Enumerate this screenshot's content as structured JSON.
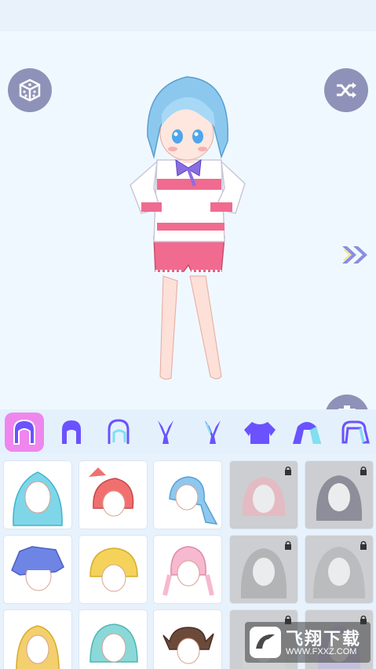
{
  "toolbar": {
    "categories": [
      {
        "name": "hair-full",
        "selected": true
      },
      {
        "name": "hair-back",
        "selected": false
      },
      {
        "name": "hair-front",
        "selected": false
      },
      {
        "name": "ears",
        "selected": false
      },
      {
        "name": "ears-outline",
        "selected": false
      },
      {
        "name": "top",
        "selected": false
      },
      {
        "name": "outer-hair",
        "selected": false
      },
      {
        "name": "headwear",
        "selected": false
      }
    ]
  },
  "grid": {
    "items": [
      {
        "hair_color": "#7fd6e8",
        "locked": false
      },
      {
        "hair_color": "#f07070",
        "locked": false
      },
      {
        "hair_color": "#8ec8ee",
        "locked": false
      },
      {
        "hair_color": "#f3a6b2",
        "locked": true
      },
      {
        "hair_color": "#555566",
        "locked": true
      },
      {
        "hair_color": "#6f85e6",
        "locked": false
      },
      {
        "hair_color": "#f5d35a",
        "locked": false
      },
      {
        "hair_color": "#f6b9cf",
        "locked": false
      },
      {
        "hair_color": "#9a9a9a",
        "locked": true
      },
      {
        "hair_color": "#a8a8a8",
        "locked": true
      },
      {
        "hair_color": "#f4cf6e",
        "locked": false
      },
      {
        "hair_color": "#8ad8d8",
        "locked": false
      },
      {
        "hair_color": "#6b4a3a",
        "locked": false
      },
      {
        "hair_color": "#cfcfcf",
        "locked": true
      },
      {
        "hair_color": "#b9b0e0",
        "locked": true
      }
    ]
  },
  "character": {
    "hair_color": "#8cc8ee",
    "shirt_color": "#ffffff",
    "stripe_color": "#f06b8f",
    "shorts_color": "#f06b8f",
    "bow_color": "#8a6ee0"
  },
  "watermark": {
    "title": "飞翔下载",
    "url": "WWW.FXXZ.COM"
  },
  "colors": {
    "accent": "#ee86ee",
    "icon_blue": "#6b52ff",
    "button_gray": "#8f92b8"
  }
}
